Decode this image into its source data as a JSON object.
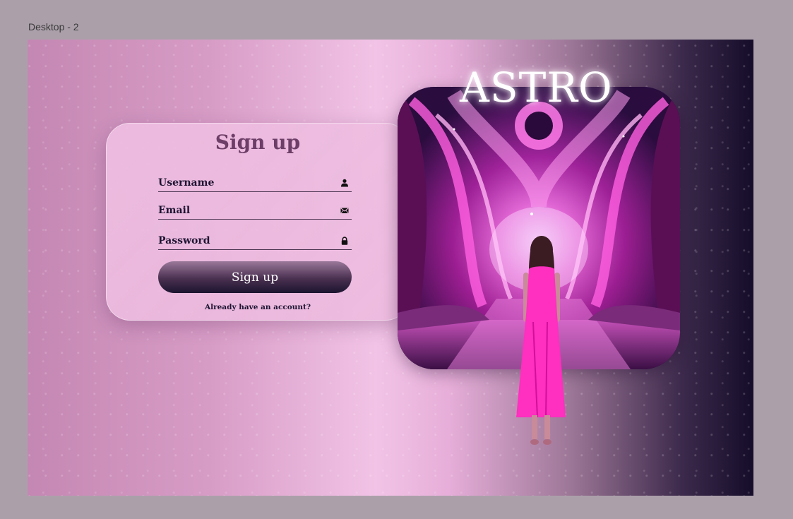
{
  "frame": {
    "label": "Desktop - 2"
  },
  "brand": {
    "title": "ASTRO"
  },
  "form": {
    "title": "Sign up",
    "fields": [
      {
        "label": "Username",
        "icon": "user-icon"
      },
      {
        "label": "Email",
        "icon": "envelope-icon"
      },
      {
        "label": "Password",
        "icon": "lock-icon"
      }
    ],
    "submit_label": "Sign up",
    "login_link": "Already have an account?"
  },
  "colors": {
    "title": "#6d3e67",
    "text": "#1d1432",
    "button_dark": "#1b1430",
    "card": "#ecbadd",
    "background_dark": "#150d2a"
  }
}
